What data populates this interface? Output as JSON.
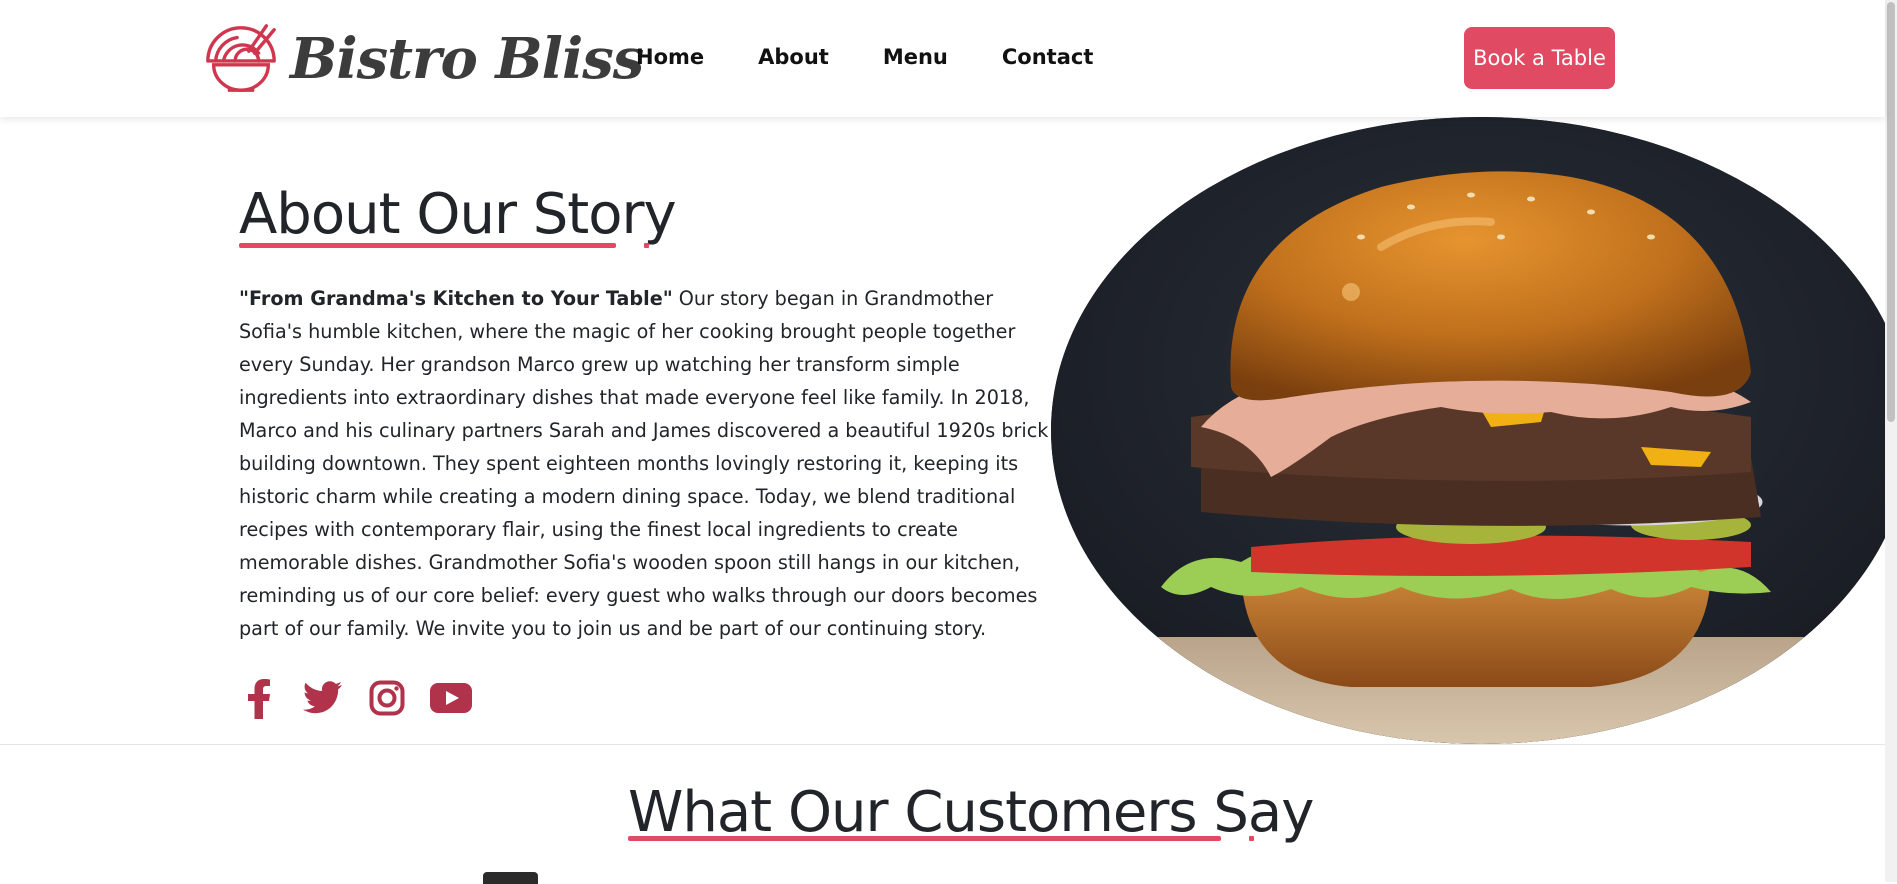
{
  "header": {
    "logo_text": "Bistro Bliss",
    "logo_icon": "noodle-bowl-icon",
    "nav": [
      "Home",
      "About",
      "Menu",
      "Contact"
    ],
    "cta_label": "Book a Table"
  },
  "about": {
    "title": "About Our Story",
    "lead": "\"From Grandma's Kitchen to Your Table\"",
    "body": " Our story began in Grandmother Sofia's humble kitchen, where the magic of her cooking brought people together every Sunday. Her grandson Marco grew up watching her transform simple ingredients into extraordinary dishes that made everyone feel like family. In 2018, Marco and his culinary partners Sarah and James discovered a beautiful 1920s brick building downtown. They spent eighteen months lovingly restoring it, keeping its historic charm while creating a modern dining space. Today, we blend traditional recipes with contemporary flair, using the finest local ingredients to create memorable dishes. Grandmother Sofia's wooden spoon still hangs in our kitchen, reminding us of our core belief: every guest who walks through our doors becomes part of our family. We invite you to join us and be part of our continuing story.",
    "socials": [
      "facebook-icon",
      "twitter-icon",
      "instagram-icon",
      "youtube-icon"
    ]
  },
  "testimonials": {
    "title": "What Our Customers Say"
  },
  "colors": {
    "accent": "#e04a62",
    "social": "#b0324b",
    "heading": "#212529"
  }
}
